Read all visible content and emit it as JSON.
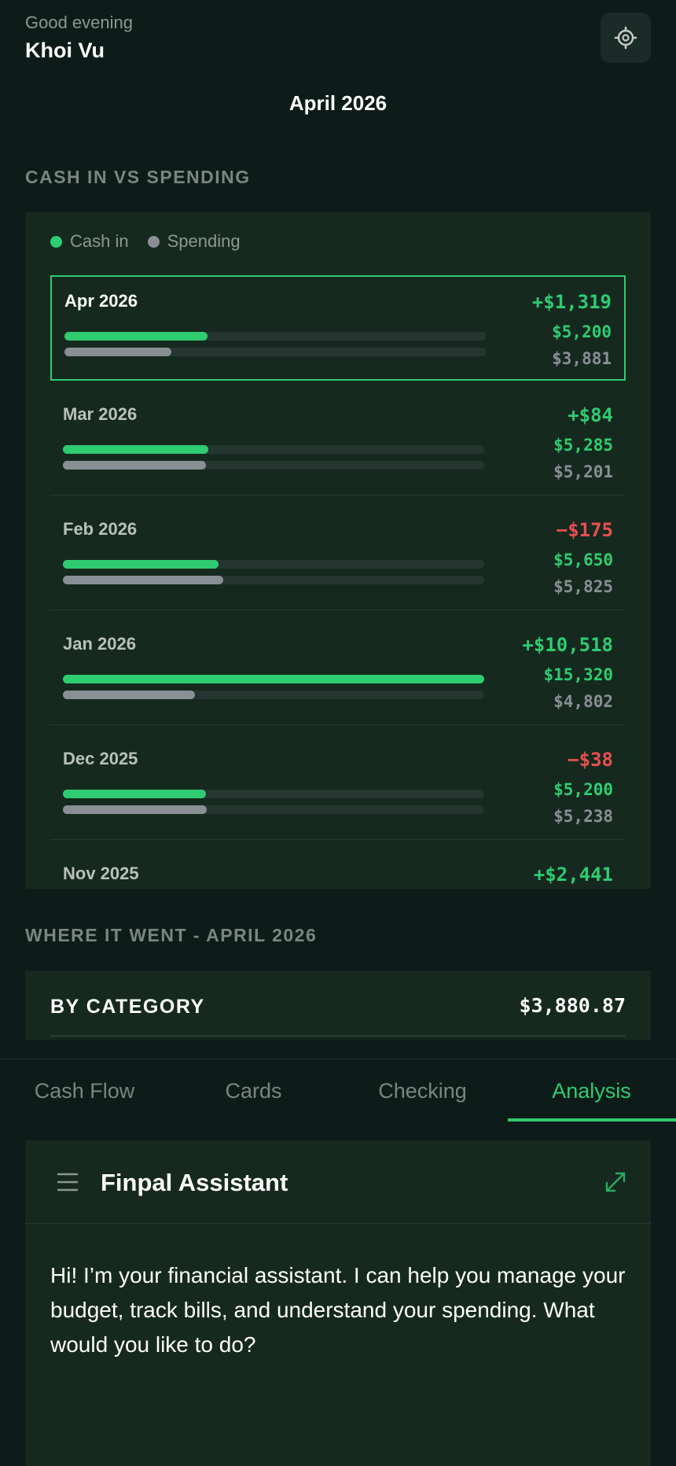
{
  "header": {
    "greeting": "Good evening",
    "user_name": "Khoi Vu",
    "settings_icon": "gear-icon"
  },
  "period": "April 2026",
  "cash_section": {
    "label": "CASH IN VS SPENDING",
    "legend": [
      {
        "label": "Cash in",
        "color": "#2ecc71"
      },
      {
        "label": "Spending",
        "color": "#8a8f96"
      }
    ],
    "months": [
      {
        "label": "Apr 2026",
        "net": "+$1,319",
        "net_sign": "pos",
        "cash_in": "$5,200",
        "spending": "$3,881",
        "in_fraction": 0.339,
        "out_fraction": 0.253,
        "selected": true
      },
      {
        "label": "Mar 2026",
        "net": "+$84",
        "net_sign": "pos",
        "cash_in": "$5,285",
        "spending": "$5,201",
        "in_fraction": 0.345,
        "out_fraction": 0.339,
        "selected": false
      },
      {
        "label": "Feb 2026",
        "net": "−$175",
        "net_sign": "neg",
        "cash_in": "$5,650",
        "spending": "$5,825",
        "in_fraction": 0.369,
        "out_fraction": 0.38,
        "selected": false
      },
      {
        "label": "Jan 2026",
        "net": "+$10,518",
        "net_sign": "pos",
        "cash_in": "$15,320",
        "spending": "$4,802",
        "in_fraction": 1.0,
        "out_fraction": 0.313,
        "selected": false
      },
      {
        "label": "Dec 2025",
        "net": "−$38",
        "net_sign": "neg",
        "cash_in": "$5,200",
        "spending": "$5,238",
        "in_fraction": 0.339,
        "out_fraction": 0.342,
        "selected": false
      },
      {
        "label": "Nov 2025",
        "net": "+$2,441",
        "net_sign": "pos",
        "cash_in": "",
        "spending": "",
        "in_fraction": 0,
        "out_fraction": 0,
        "selected": false
      }
    ]
  },
  "where_section": {
    "label": "WHERE IT WENT - APRIL 2026",
    "category_title": "BY CATEGORY",
    "category_total": "$3,880.87"
  },
  "tabs": [
    {
      "label": "Cash Flow",
      "active": false
    },
    {
      "label": "Cards",
      "active": false
    },
    {
      "label": "Checking",
      "active": false
    },
    {
      "label": "Analysis",
      "active": true
    }
  ],
  "assistant": {
    "title": "Finpal Assistant",
    "menu_icon": "hamburger-menu-icon",
    "expand_icon": "expand-icon",
    "message": "Hi! I’m your financial assistant. I can help you manage your budget, track bills, and understand your spending. What would you like to do?"
  },
  "colors": {
    "accent": "#2ecc71",
    "negative": "#e85050",
    "spending": "#8a8f96",
    "background": "#0d1c19",
    "panel": "#16291f"
  }
}
